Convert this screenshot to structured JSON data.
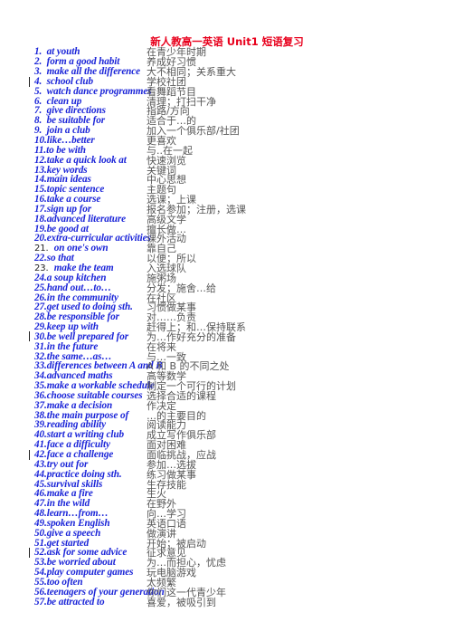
{
  "title": "新人教高一英语 Unit1 短语复习",
  "items": [
    {
      "num": "1.",
      "en": "at youth",
      "zh": "在青少年时期"
    },
    {
      "num": "2.",
      "en": "form a good habit",
      "zh": "养成好习惯"
    },
    {
      "num": "3.",
      "en": "make all the difference",
      "zh": "大不相同；关系重大"
    },
    {
      "num": "4.",
      "en": "school club",
      "zh": "学校社团",
      "marker": true
    },
    {
      "num": "5.",
      "en": "watch dance programmes",
      "zh": "看舞蹈节目"
    },
    {
      "num": "6.",
      "en": "clean up",
      "zh": "清理；打扫干净"
    },
    {
      "num": "7.",
      "en": "give directions",
      "zh": "指路/方向"
    },
    {
      "num": "8.",
      "en": "be suitable for",
      "zh": "适合于…的"
    },
    {
      "num": "9.",
      "en": "join a club",
      "zh": "加入一个俱乐部/社团"
    },
    {
      "num": "10.",
      "en": "like…better",
      "zh": "更喜欢"
    },
    {
      "num": "11.",
      "en": "to be with",
      "zh": "与..在一起"
    },
    {
      "num": "12.",
      "en": "take a quick look at",
      "zh": "快速浏览"
    },
    {
      "num": "13.",
      "en": "key words",
      "zh": "关键词"
    },
    {
      "num": "14.",
      "en": "main ideas",
      "zh": "中心思想"
    },
    {
      "num": "15.",
      "en": "topic sentence",
      "zh": "主题句"
    },
    {
      "num": "16.",
      "en": "take a course",
      "zh": "选课；上课"
    },
    {
      "num": "17.",
      "en": "sign up for",
      "zh": "报名参加；注册，选课"
    },
    {
      "num": "18.",
      "en": "advanced literature",
      "zh": "高级文学"
    },
    {
      "num": "19.",
      "en": "be good at",
      "zh": "擅长做…"
    },
    {
      "num": "20.",
      "en": "extra-curricular activities",
      "zh": "课外活动"
    },
    {
      "num": "21.",
      "en": "on one's own",
      "zh": "靠自己",
      "plainNum": true
    },
    {
      "num": "22.",
      "en": "so that",
      "zh": "以便；所以"
    },
    {
      "num": "23.",
      "en": "make the team",
      "zh": "入选球队",
      "plainNum": true
    },
    {
      "num": "24.",
      "en": "a soup kitchen",
      "zh": "施粥场"
    },
    {
      "num": "25.",
      "en": "hand out…to…",
      "zh": "分发；施舍…给"
    },
    {
      "num": "26.",
      "en": "in the community",
      "zh": "在社区"
    },
    {
      "num": "27.",
      "en": "get used to doing sth.",
      "zh": "习惯做某事"
    },
    {
      "num": "28.",
      "en": "be responsible for",
      "zh": "对……负责"
    },
    {
      "num": "29.",
      "en": "keep up with",
      "zh": "赶得上；和…保持联系"
    },
    {
      "num": "30.",
      "en": "be well prepared for",
      "zh": "为…作好充分的准备",
      "marker": true
    },
    {
      "num": "31.",
      "en": "in the future",
      "zh": "在将来"
    },
    {
      "num": "32.",
      "en": "the same…as…",
      "zh": "与…一致"
    },
    {
      "num": "33.",
      "en": "differences between A and B",
      "zh": "A 和 B 的不同之处"
    },
    {
      "num": "34.",
      "en": "advanced maths",
      "zh": "高等数学"
    },
    {
      "num": "35.",
      "en": "make a workable schedule",
      "zh": "制定一个可行的计划"
    },
    {
      "num": "36.",
      "en": "choose suitable courses",
      "zh": "选择合适的课程"
    },
    {
      "num": "37.",
      "en": "make a decision",
      "zh": "作决定"
    },
    {
      "num": "38.",
      "en": "the main purpose of",
      "zh": "…的主要目的"
    },
    {
      "num": "39.",
      "en": "reading ability",
      "zh": "阅读能力"
    },
    {
      "num": "40.",
      "en": "start a writing club",
      "zh": "成立写作俱乐部"
    },
    {
      "num": "41.",
      "en": "face a difficulty",
      "zh": "面对困难"
    },
    {
      "num": "42.",
      "en": "face a challenge",
      "zh": "面临挑战，应战",
      "marker": true
    },
    {
      "num": "43.",
      "en": "try out for",
      "zh": "参加…选拔"
    },
    {
      "num": "44.",
      "en": "practice doing sth.",
      "zh": "练习做某事"
    },
    {
      "num": "45.",
      "en": "survival skills",
      "zh": "生存技能"
    },
    {
      "num": "46.",
      "en": "make a fire",
      "zh": "生火"
    },
    {
      "num": "47.",
      "en": "in the wild",
      "zh": "在野外"
    },
    {
      "num": "48.",
      "en": "learn…from…",
      "zh": "向…学习"
    },
    {
      "num": "49.",
      "en": "spoken English",
      "zh": "英语口语"
    },
    {
      "num": "50.",
      "en": "give a speech",
      "zh": "做演讲"
    },
    {
      "num": "51.",
      "en": "get started",
      "zh": "开始；被启动"
    },
    {
      "num": "52.",
      "en": "ask for some advice",
      "zh": "征求意见",
      "marker": true
    },
    {
      "num": "53.",
      "en": "be worried about",
      "zh": "为…而担心，忧虑"
    },
    {
      "num": "54.",
      "en": "play computer games",
      "zh": "玩电脑游戏"
    },
    {
      "num": "55.",
      "en": "too often",
      "zh": "太频繁"
    },
    {
      "num": "56.",
      "en": "teenagers of your generation",
      "zh": "你们这一代青少年"
    },
    {
      "num": "57.",
      "en": "be attracted to",
      "zh": "喜爱，被吸引到"
    }
  ]
}
